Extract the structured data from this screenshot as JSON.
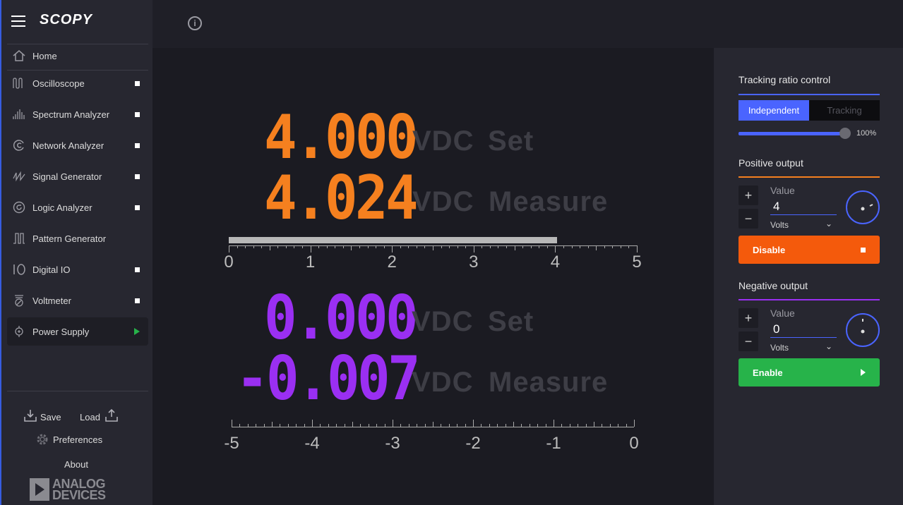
{
  "app": {
    "logo": "SCOPY"
  },
  "sidebar": {
    "items": [
      {
        "label": "Home",
        "icon": "home-icon",
        "status": "none"
      },
      {
        "label": "Oscilloscope",
        "icon": "oscilloscope-icon",
        "status": "stopped"
      },
      {
        "label": "Spectrum Analyzer",
        "icon": "spectrum-icon",
        "status": "stopped"
      },
      {
        "label": "Network Analyzer",
        "icon": "network-icon",
        "status": "stopped"
      },
      {
        "label": "Signal Generator",
        "icon": "signal-icon",
        "status": "stopped"
      },
      {
        "label": "Logic Analyzer",
        "icon": "logic-icon",
        "status": "stopped"
      },
      {
        "label": "Pattern Generator",
        "icon": "pattern-icon",
        "status": "none"
      },
      {
        "label": "Digital IO",
        "icon": "digital-io-icon",
        "status": "stopped"
      },
      {
        "label": "Voltmeter",
        "icon": "voltmeter-icon",
        "status": "stopped"
      },
      {
        "label": "Power Supply",
        "icon": "power-supply-icon",
        "status": "running"
      }
    ],
    "save_label": "Save",
    "load_label": "Load",
    "preferences_label": "Preferences",
    "about_label": "About",
    "brand_line1": "ANALOG",
    "brand_line2": "DEVICES"
  },
  "main": {
    "positive": {
      "set_value": "4.000",
      "measure_value": "4.024",
      "set_unit": "VDC",
      "set_label": "Set",
      "measure_unit": "VDC",
      "measure_label": "Measure",
      "bar_level": 4.024,
      "scale": [
        "0",
        "1",
        "2",
        "3",
        "4",
        "5"
      ]
    },
    "negative": {
      "set_value": "0.000",
      "measure_value": "-0.007",
      "set_unit": "VDC",
      "set_label": "Set",
      "measure_unit": "VDC",
      "measure_label": "Measure",
      "scale": [
        "-5",
        "-4",
        "-3",
        "-2",
        "-1",
        "0"
      ]
    }
  },
  "panel": {
    "tracking_title": "Tracking ratio control",
    "mode_independent": "Independent",
    "mode_tracking": "Tracking",
    "ratio_percent": "100%",
    "positive_title": "Positive output",
    "positive_value_label": "Value",
    "positive_value": "4",
    "positive_unit": "Volts",
    "positive_button": "Disable",
    "negative_title": "Negative output",
    "negative_value_label": "Value",
    "negative_value": "0",
    "negative_unit": "Volts",
    "negative_button": "Enable",
    "plus": "+",
    "minus": "−",
    "colors": {
      "positive": "#f5801f",
      "negative": "#9a2ff2",
      "accent": "#4a64ff",
      "disable_btn": "#f45a0c",
      "enable_btn": "#27b34a"
    }
  }
}
